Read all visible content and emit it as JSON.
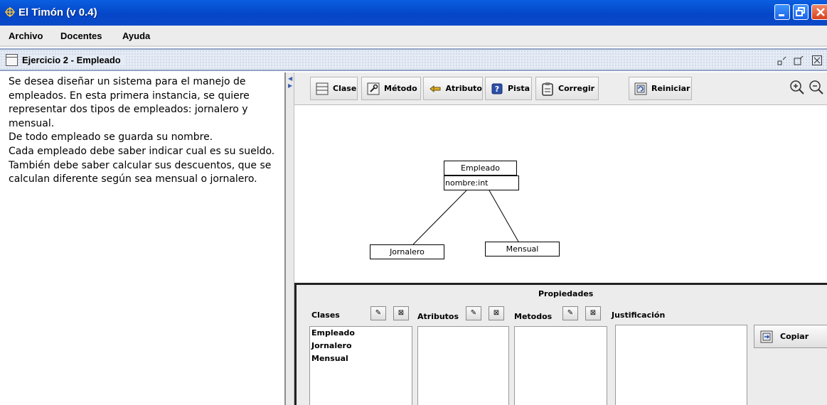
{
  "window": {
    "title": "El Timón (v 0.4)"
  },
  "menu": [
    "Archivo",
    "Docentes",
    "Ayuda"
  ],
  "frame": {
    "title": "Ejercicio 2 - Empleado"
  },
  "statement": [
    "Se desea diseñar un sistema para el manejo de empleados. En esta primera instancia, se quiere representar dos tipos de empleados: jornalero y mensual.",
    "De todo empleado se guarda su nombre.",
    "Cada empleado debe saber indicar cual es su sueldo. También debe saber calcular sus descuentos,  que se calculan diferente según sea mensual o jornalero."
  ],
  "toolbar": {
    "clase": "Clase",
    "metodo": "Método",
    "atributo": "Atributo",
    "pista": "Pista",
    "corregir": "Corregir",
    "reiniciar": "Reiniciar"
  },
  "diagram": {
    "base_class": "Empleado",
    "base_attribute": "nombre:int",
    "sub_left": "Jornalero",
    "sub_right": "Mensual"
  },
  "properties": {
    "title": "Propiedades",
    "clases_label": "Clases",
    "atributos_label": "Atributos",
    "metodos_label": "Metodos",
    "justificacion_label": "Justificación",
    "classes": [
      "Empleado",
      "Jornalero",
      "Mensual"
    ],
    "copy_button": "Copiar"
  },
  "colors": {
    "titlebar": "#0546c8",
    "close_button": "#d8401c"
  }
}
